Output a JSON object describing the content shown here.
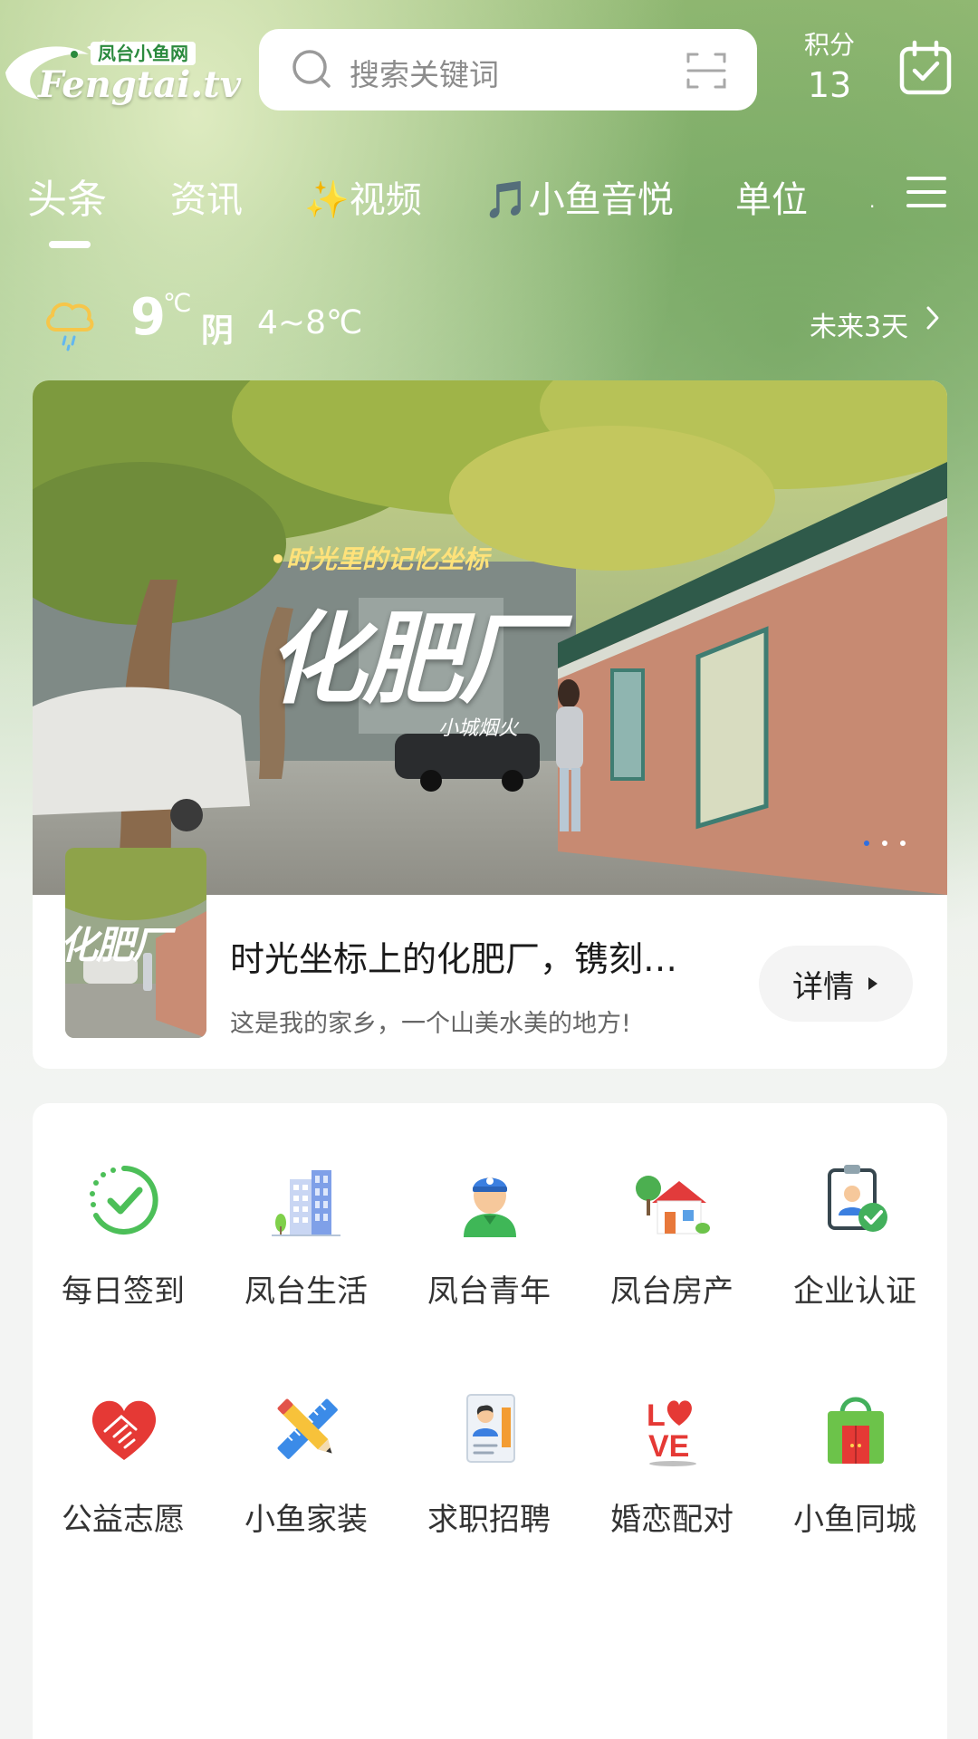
{
  "header": {
    "logo_badge": "凤台小鱼网",
    "logo_text": "Fengtai.tv",
    "search_placeholder": "搜索关键词",
    "points_label": "积分",
    "points_value": "13"
  },
  "tabs": [
    {
      "label": "头条",
      "active": true
    },
    {
      "label": "资讯",
      "active": false
    },
    {
      "label": "✨视频",
      "active": false
    },
    {
      "label": "🎵小鱼音悦",
      "active": false
    },
    {
      "label": "单位",
      "active": false
    }
  ],
  "weather": {
    "temp": "9",
    "unit": "℃",
    "condition": "阴",
    "range": "4~8℃",
    "forecast_link": "未来3天"
  },
  "banner": {
    "photo_subtitle": "•时光里的记忆坐标",
    "photo_title": "化肥厂",
    "photo_signature": "小城烟火",
    "slide_count": 3,
    "active_slide": 1,
    "news_title": "时光坐标上的化肥厂，镌刻…",
    "news_subtitle": "这是我的家乡，一个山美水美的地方!",
    "detail_label": "详情"
  },
  "grid": [
    {
      "label": "每日签到",
      "icon": "check-circle-icon"
    },
    {
      "label": "凤台生活",
      "icon": "buildings-icon"
    },
    {
      "label": "凤台青年",
      "icon": "young-person-icon"
    },
    {
      "label": "凤台房产",
      "icon": "house-icon"
    },
    {
      "label": "企业认证",
      "icon": "badge-verified-icon"
    },
    {
      "label": "公益志愿",
      "icon": "heart-hands-icon"
    },
    {
      "label": "小鱼家装",
      "icon": "ruler-pencil-icon"
    },
    {
      "label": "求职招聘",
      "icon": "resume-icon"
    },
    {
      "label": "婚恋配对",
      "icon": "love-icon"
    },
    {
      "label": "小鱼同城",
      "icon": "shopping-bag-icon"
    }
  ],
  "colors": {
    "accent_green": "#2b8a3e",
    "dot_active": "#2f6fe0"
  }
}
